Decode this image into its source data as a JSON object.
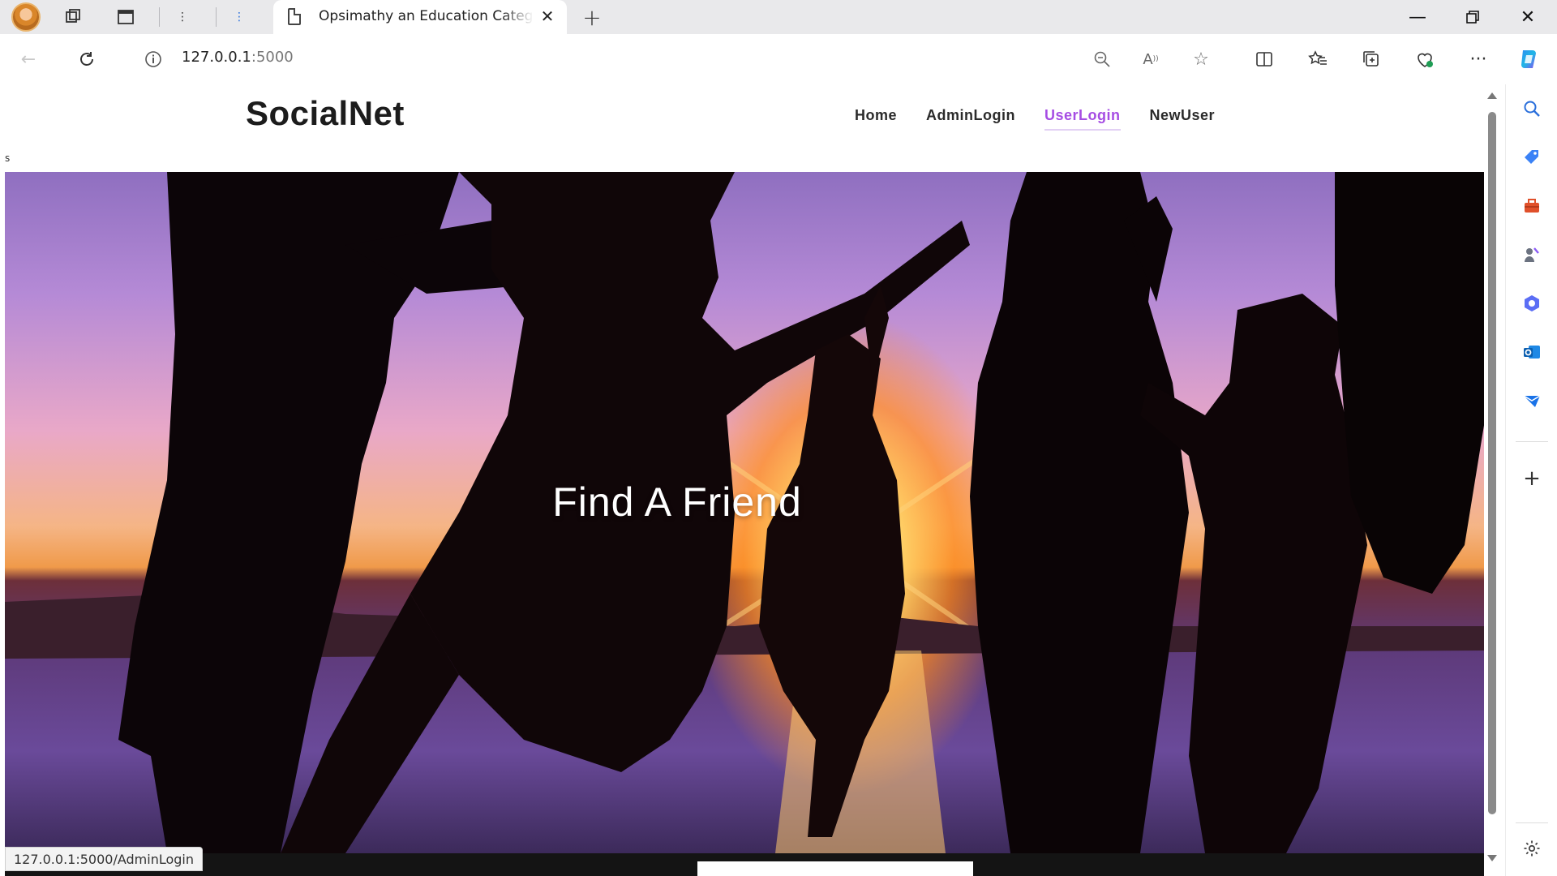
{
  "browser": {
    "tab_title": "Opsimathy an Education Catego",
    "url_host": "127.0.0.1",
    "url_port": ":5000",
    "status_url": "127.0.0.1:5000/AdminLogin"
  },
  "site": {
    "logo": "SocialNet",
    "nav": [
      {
        "label": "Home",
        "active": false
      },
      {
        "label": "AdminLogin",
        "active": false
      },
      {
        "label": "UserLogin",
        "active": true
      },
      {
        "label": "NewUser",
        "active": false
      }
    ],
    "stray_text": "s",
    "hero_title": "Find A Friend"
  },
  "colors": {
    "nav_active": "#a64de3",
    "logo": "#1c1c1c"
  }
}
